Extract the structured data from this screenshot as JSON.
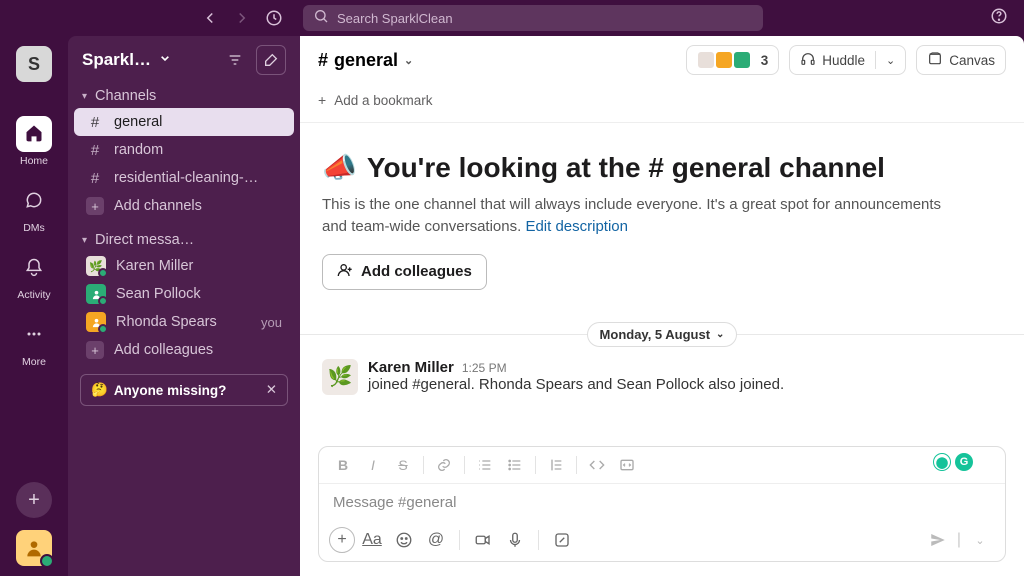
{
  "search": {
    "placeholder": "Search SparklClean"
  },
  "workspace": {
    "letter": "S",
    "name": "Sparkl…"
  },
  "rail": {
    "home": "Home",
    "dms": "DMs",
    "activity": "Activity",
    "more": "More"
  },
  "sidebar": {
    "sections": {
      "channels": "Channels",
      "dms": "Direct messa…"
    },
    "channels": [
      {
        "name": "general"
      },
      {
        "name": "random"
      },
      {
        "name": "residential-cleaning-…"
      }
    ],
    "add_channels": "Add channels",
    "dms": [
      {
        "name": "Karen Miller",
        "you": false
      },
      {
        "name": "Sean Pollock",
        "you": false
      },
      {
        "name": "Rhonda Spears",
        "you": true
      }
    ],
    "add_colleagues": "Add colleagues",
    "you_label": "you",
    "missing": {
      "emoji": "🤔",
      "text": "Anyone missing?"
    }
  },
  "header": {
    "channel": "general",
    "member_count": "3",
    "huddle": "Huddle",
    "canvas": "Canvas",
    "add_bookmark": "Add a bookmark"
  },
  "intro": {
    "emoji": "📣",
    "prefix": "You're looking at the ",
    "hash": "#",
    "channel": "general",
    "suffix": " channel",
    "desc": "This is the one channel that will always include everyone. It's a great spot for announcements and team-wide conversations. ",
    "edit_link": "Edit description",
    "add_colleagues": "Add colleagues"
  },
  "divider": {
    "date": "Monday, 5 August"
  },
  "message": {
    "author": "Karen Miller",
    "time": "1:25 PM",
    "text": "joined #general. Rhonda Spears and Sean Pollock also joined."
  },
  "composer": {
    "placeholder": "Message #general"
  },
  "colors": {
    "member_av": [
      "#e8e0d8",
      "#f5a623",
      "#2bac76"
    ]
  }
}
